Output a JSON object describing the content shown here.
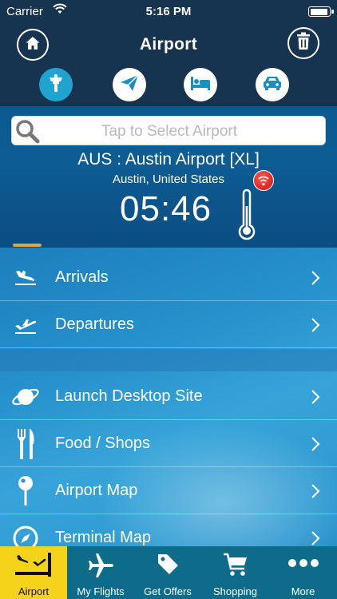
{
  "status_bar": {
    "carrier": "Carrier",
    "time": "5:16 PM"
  },
  "nav": {
    "title": "Airport"
  },
  "categories": [
    {
      "icon": "control-tower-icon",
      "active": true
    },
    {
      "icon": "paper-plane-icon",
      "active": false
    },
    {
      "icon": "bed-icon",
      "active": false
    },
    {
      "icon": "car-icon",
      "active": false
    }
  ],
  "search": {
    "placeholder": "Tap to Select Airport"
  },
  "airport": {
    "name": "AUS : Austin Airport [XL]",
    "city": "Austin, United States",
    "local_time": "05:46"
  },
  "menu": {
    "group1": [
      {
        "label": "Arrivals",
        "icon": "arrival-plane-icon"
      },
      {
        "label": "Departures",
        "icon": "departure-plane-icon"
      }
    ],
    "group2": [
      {
        "label": "Launch Desktop Site",
        "icon": "planet-icon"
      },
      {
        "label": "Food / Shops",
        "icon": "fork-knife-icon"
      },
      {
        "label": "Airport Map",
        "icon": "map-pin-icon"
      },
      {
        "label": "Terminal Map",
        "icon": "compass-icon"
      }
    ]
  },
  "tabs": [
    {
      "label": "Airport",
      "icon": "airport-tab-icon",
      "active": true
    },
    {
      "label": "My Flights",
      "icon": "airplane-icon",
      "active": false
    },
    {
      "label": "Get Offers",
      "icon": "tag-icon",
      "active": false
    },
    {
      "label": "Shopping",
      "icon": "shopping-cart-icon",
      "active": false
    },
    {
      "label": "More",
      "icon": "more-dots-icon",
      "active": false
    }
  ],
  "colors": {
    "header_bg": "#16344f",
    "active_category": "#1fa4cf",
    "tabbar_bg": "#0c6c8a",
    "active_tab": "#f5d31b"
  }
}
